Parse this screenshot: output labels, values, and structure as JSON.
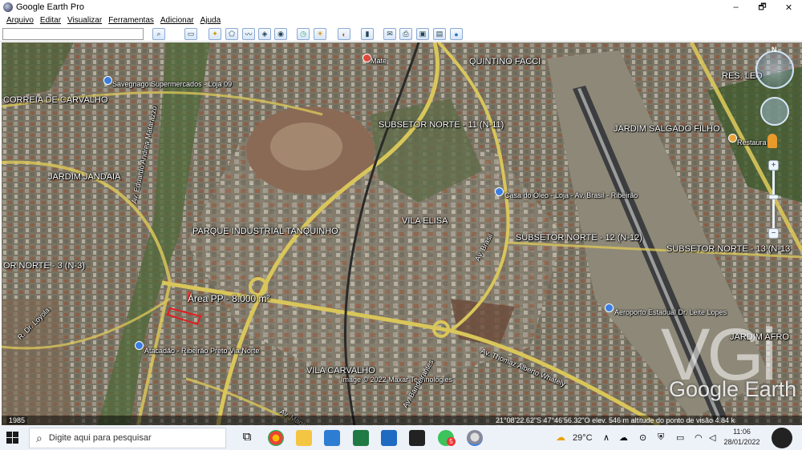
{
  "window": {
    "title": "Google Earth Pro",
    "minimize": "–",
    "maximize": "🗗",
    "close": "✕"
  },
  "menu": [
    "Arquivo",
    "Editar",
    "Visualizar",
    "Ferramentas",
    "Adicionar",
    "Ajuda"
  ],
  "toolbar": {
    "search_value": ""
  },
  "map": {
    "labels": [
      {
        "text": "Mate",
        "cls": "small"
      },
      {
        "text": "QUINTINO FACCI",
        "cls": ""
      },
      {
        "text": "Savegnago Supermercados - Loja 09",
        "cls": "small"
      },
      {
        "text": "RES. LEO",
        "cls": ""
      },
      {
        "text": "CORREIA DE CARVALHO",
        "cls": ""
      },
      {
        "text": "SUBSETOR NORTE - 11 (N-11)",
        "cls": ""
      },
      {
        "text": "JARDIM SALGADO FILHO",
        "cls": ""
      },
      {
        "text": "Restaura",
        "cls": "small"
      },
      {
        "text": "JARDIM JANDAIA",
        "cls": ""
      },
      {
        "text": "Av. Eduardo Andrea Matarazzo",
        "cls": "small"
      },
      {
        "text": "Casa do Óleo - Loja - Av. Brasil - Ribeirão",
        "cls": "small"
      },
      {
        "text": "VILA ELISA",
        "cls": ""
      },
      {
        "text": "PARQUE INDUSTRIAL TANQUINHO",
        "cls": ""
      },
      {
        "text": "Av. Brasil",
        "cls": "small"
      },
      {
        "text": "SUBSETOR NORTE - 12 (N-12)",
        "cls": ""
      },
      {
        "text": "SUBSETOR NORTE - 13 (N-13",
        "cls": ""
      },
      {
        "text": "OR NORTE - 3 (N-3)",
        "cls": ""
      },
      {
        "text": "Área PP - 8.000 m²",
        "cls": "big"
      },
      {
        "text": "Aeroporto Estadual Dr. Leite Lopes",
        "cls": "small"
      },
      {
        "text": "R. Dr. Loyola",
        "cls": "small"
      },
      {
        "text": "JARDIM AFRO",
        "cls": ""
      },
      {
        "text": "Atacadão - Ribeirão Preto Via Norte",
        "cls": "small"
      },
      {
        "text": "Av. Thomaz Alberto Whately",
        "cls": "small"
      },
      {
        "text": "VILA CARVALHO",
        "cls": ""
      },
      {
        "text": "Image © 2022 Maxar Technologies",
        "cls": "small"
      },
      {
        "text": "Av. Bandeirantes",
        "cls": "small"
      },
      {
        "text": "Av. Magalhães",
        "cls": "small"
      }
    ],
    "watermark": "VGi",
    "logo": "Google Earth",
    "year": "1985",
    "status": "21°08'22.62\"S   47°46'56.32\"O   elev.  546 m     altitude do ponto de visão   4.84 k"
  },
  "taskbar": {
    "search_placeholder": "Digite aqui para pesquisar",
    "weather": "29°C",
    "time": "11:06",
    "date": "28/01/2022",
    "notification_count": "5"
  }
}
